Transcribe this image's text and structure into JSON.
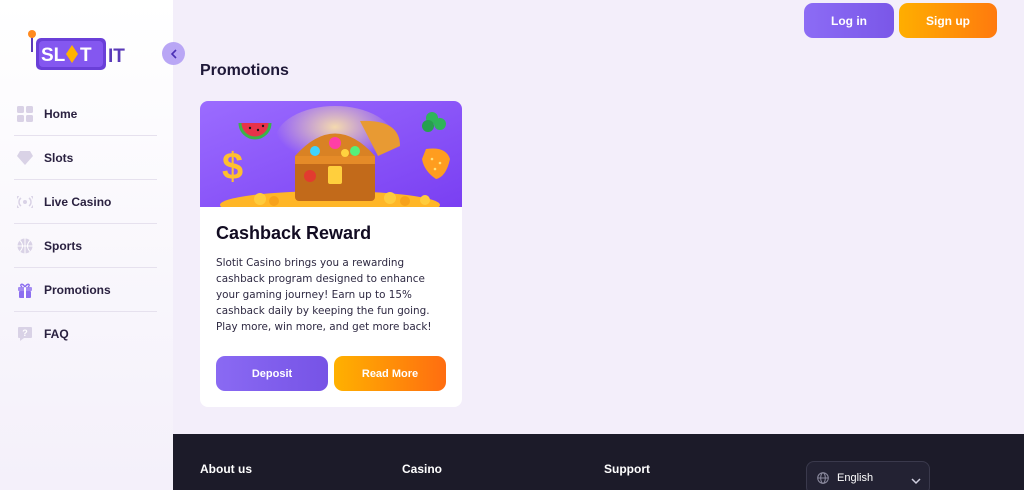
{
  "brand": {
    "logo_text": "SLOTIT"
  },
  "sidebar": {
    "collapse_icon": "chevron-left-icon",
    "items": [
      {
        "label": "Home",
        "icon": "grid-icon"
      },
      {
        "label": "Slots",
        "icon": "diamond-icon"
      },
      {
        "label": "Live Casino",
        "icon": "broadcast-icon"
      },
      {
        "label": "Sports",
        "icon": "ball-icon"
      },
      {
        "label": "Promotions",
        "icon": "gift-icon"
      },
      {
        "label": "FAQ",
        "icon": "question-bubble-icon"
      }
    ]
  },
  "header": {
    "login_label": "Log in",
    "signup_label": "Sign up"
  },
  "main": {
    "page_title": "Promotions",
    "promo": {
      "title": "Cashback Reward",
      "description": "Slotit Casino brings you a rewarding cashback program designed to enhance your gaming journey! Earn up to 15% cashback daily by keeping the fun going. Play more, win more, and get more back!",
      "deposit_label": "Deposit",
      "read_more_label": "Read More"
    }
  },
  "footer": {
    "columns": [
      "About us",
      "Casino",
      "Support"
    ],
    "language": "English"
  },
  "colors": {
    "accent_purple": "#7a57e8",
    "accent_orange": "#ff7a0e",
    "footer_bg": "#1c1b29",
    "page_bg": "#f3eefa"
  }
}
